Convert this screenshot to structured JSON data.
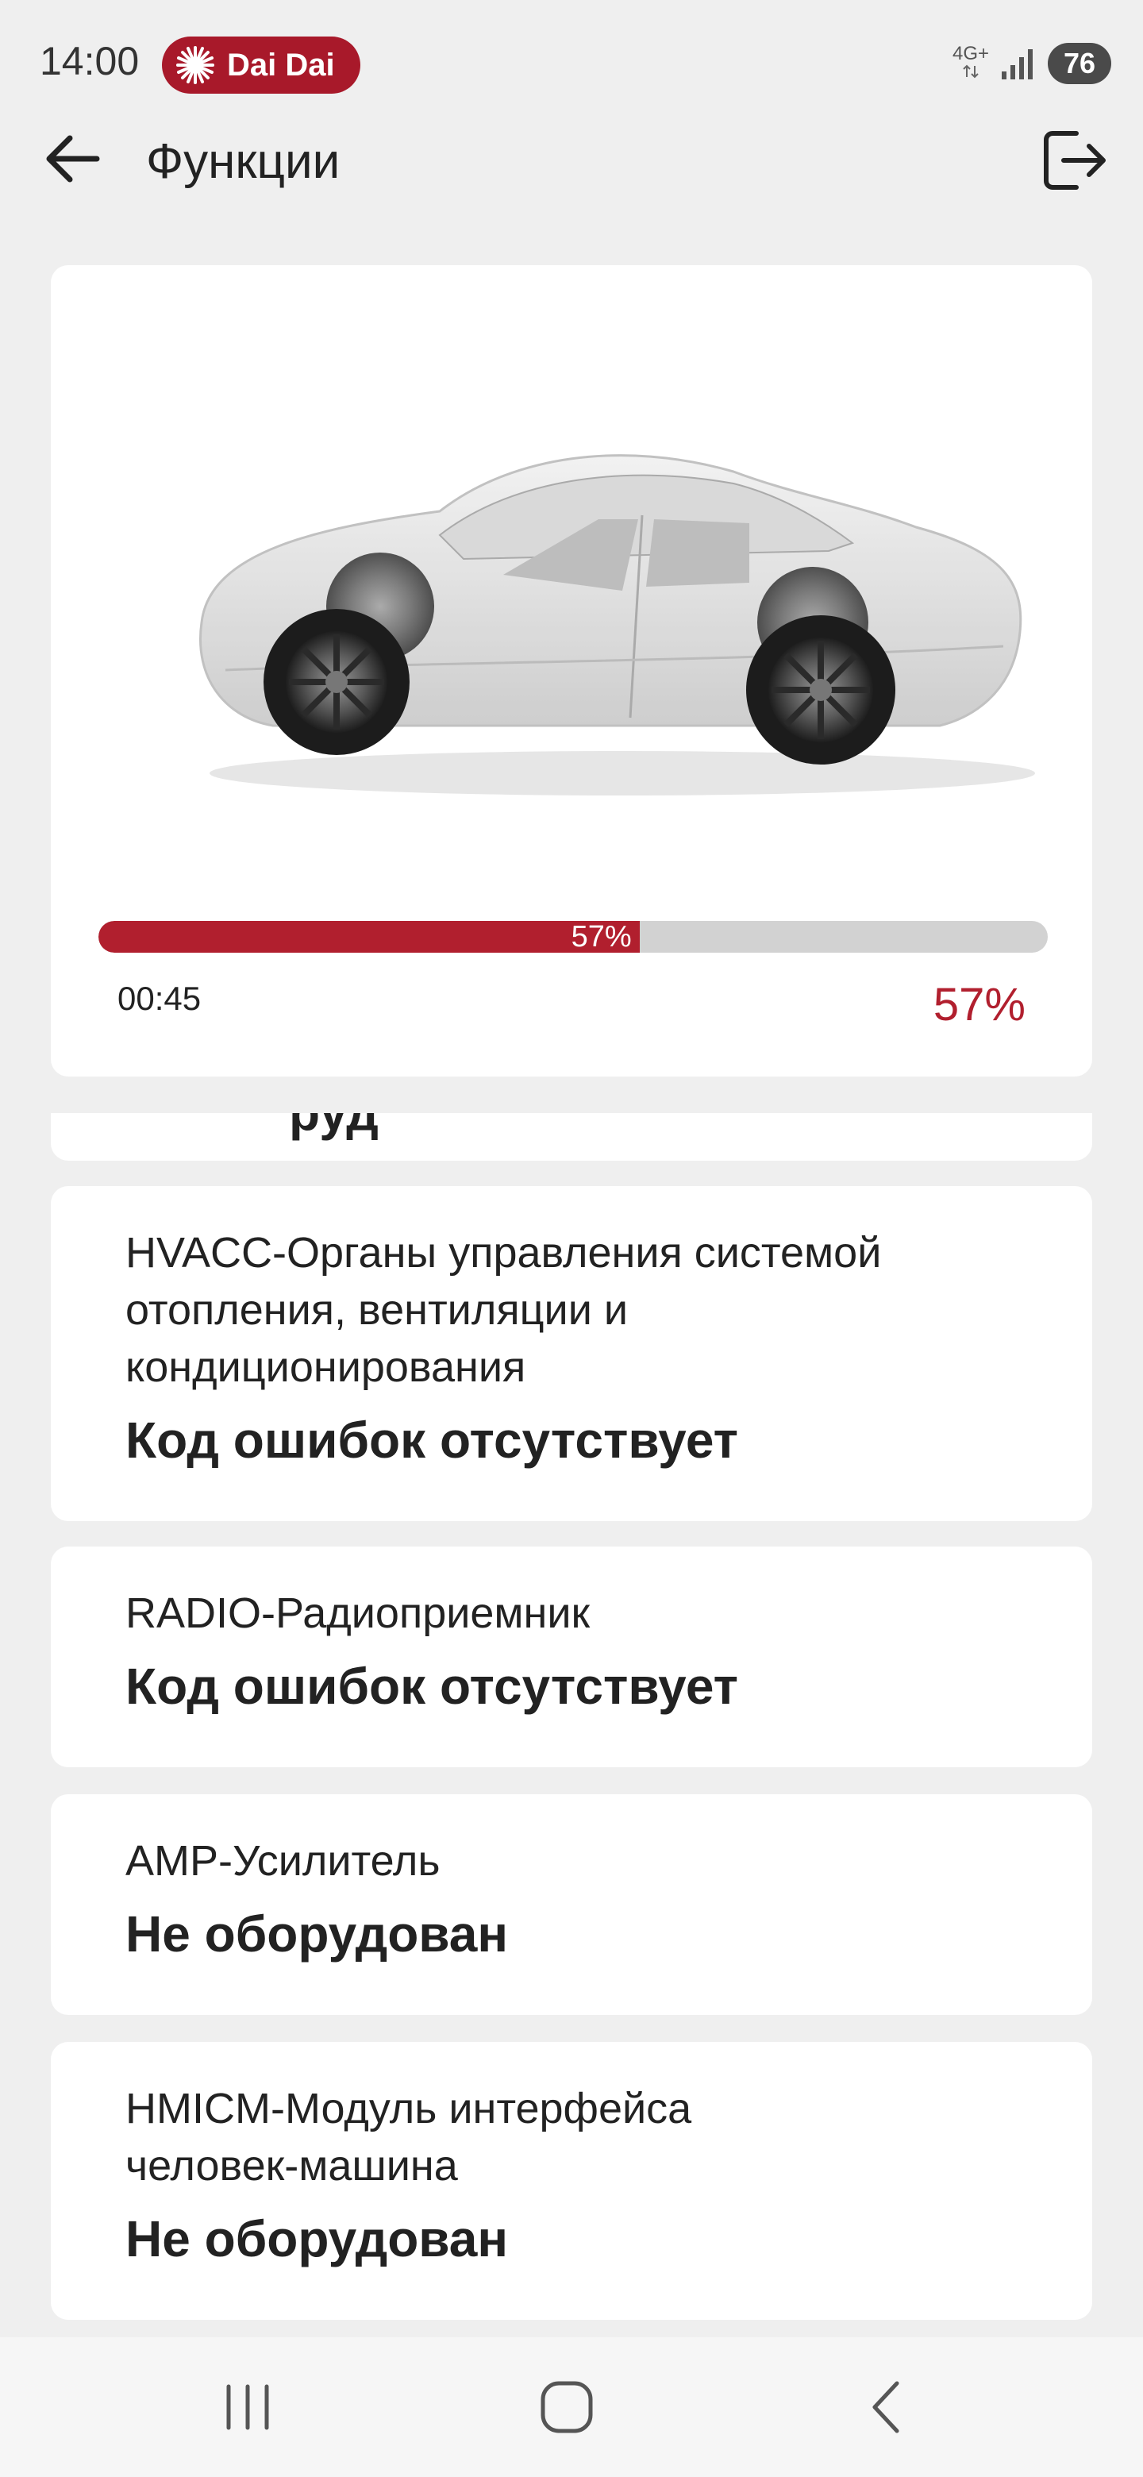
{
  "status_bar": {
    "time": "14:00",
    "notification": "Dai Dai",
    "network": "4G+",
    "battery": "76"
  },
  "app_bar": {
    "title": "Функции",
    "back_icon": "arrow-left-icon",
    "exit_icon": "logout-icon"
  },
  "progress": {
    "percent": 57,
    "percent_label": "57%",
    "elapsed": "00:45",
    "bar_color": "#b11f2e"
  },
  "modules": [
    {
      "name": "HVACC-Органы управления системой отопления, вентиляции и кондиционирования",
      "status": "Код ошибок отсутствует"
    },
    {
      "name": "RADIO-Радиоприемник",
      "status": "Код ошибок отсутствует"
    },
    {
      "name": "AMP-Усилитель",
      "status": "Не оборудован"
    },
    {
      "name": "HMICM-Модуль интерфейса человек-машина",
      "status": "Не оборудован"
    }
  ],
  "nav_bar": {
    "recent_icon": "recent-apps-icon",
    "home_icon": "home-icon",
    "back_icon": "back-chevron-icon"
  }
}
